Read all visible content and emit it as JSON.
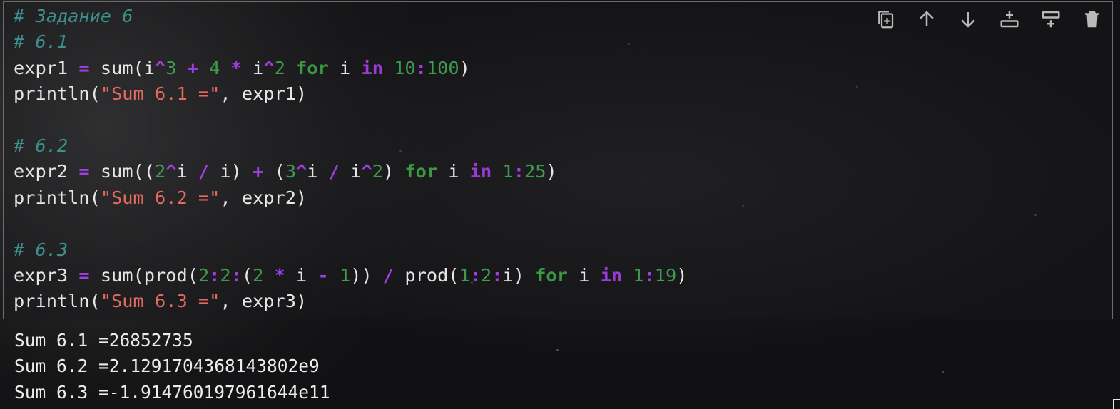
{
  "cell": {
    "lines": [
      [
        {
          "t": "# Задание 6",
          "c": "cm"
        }
      ],
      [
        {
          "t": "# 6.1",
          "c": "cm"
        }
      ],
      [
        {
          "t": "expr1 "
        },
        {
          "t": "=",
          "c": "op"
        },
        {
          "t": " sum(i"
        },
        {
          "t": "^",
          "c": "op"
        },
        {
          "t": "3",
          "c": "nm"
        },
        {
          "t": " "
        },
        {
          "t": "+",
          "c": "op"
        },
        {
          "t": " "
        },
        {
          "t": "4",
          "c": "nm"
        },
        {
          "t": " "
        },
        {
          "t": "*",
          "c": "op"
        },
        {
          "t": " i"
        },
        {
          "t": "^",
          "c": "op"
        },
        {
          "t": "2",
          "c": "nm"
        },
        {
          "t": " "
        },
        {
          "t": "for",
          "c": "kg"
        },
        {
          "t": " i "
        },
        {
          "t": "in",
          "c": "kw"
        },
        {
          "t": " "
        },
        {
          "t": "10",
          "c": "nm"
        },
        {
          "t": ":",
          "c": "op"
        },
        {
          "t": "100",
          "c": "nm"
        },
        {
          "t": ")"
        }
      ],
      [
        {
          "t": "println("
        },
        {
          "t": "\"Sum 6.1 =\"",
          "c": "st"
        },
        {
          "t": ", expr1)"
        }
      ],
      [],
      [
        {
          "t": "# 6.2",
          "c": "cm"
        }
      ],
      [
        {
          "t": "expr2 "
        },
        {
          "t": "=",
          "c": "op"
        },
        {
          "t": " sum(("
        },
        {
          "t": "2",
          "c": "nm"
        },
        {
          "t": "^",
          "c": "op"
        },
        {
          "t": "i "
        },
        {
          "t": "/",
          "c": "op"
        },
        {
          "t": " i) "
        },
        {
          "t": "+",
          "c": "op"
        },
        {
          "t": " ("
        },
        {
          "t": "3",
          "c": "nm"
        },
        {
          "t": "^",
          "c": "op"
        },
        {
          "t": "i "
        },
        {
          "t": "/",
          "c": "op"
        },
        {
          "t": " i"
        },
        {
          "t": "^",
          "c": "op"
        },
        {
          "t": "2",
          "c": "nm"
        },
        {
          "t": ") "
        },
        {
          "t": "for",
          "c": "kg"
        },
        {
          "t": " i "
        },
        {
          "t": "in",
          "c": "kw"
        },
        {
          "t": " "
        },
        {
          "t": "1",
          "c": "nm"
        },
        {
          "t": ":",
          "c": "op"
        },
        {
          "t": "25",
          "c": "nm"
        },
        {
          "t": ")"
        }
      ],
      [
        {
          "t": "println("
        },
        {
          "t": "\"Sum 6.2 =\"",
          "c": "st"
        },
        {
          "t": ", expr2)"
        }
      ],
      [],
      [
        {
          "t": "# 6.3",
          "c": "cm"
        }
      ],
      [
        {
          "t": "expr3 "
        },
        {
          "t": "=",
          "c": "op"
        },
        {
          "t": " sum(prod("
        },
        {
          "t": "2",
          "c": "nm"
        },
        {
          "t": ":",
          "c": "op"
        },
        {
          "t": "2",
          "c": "nm"
        },
        {
          "t": ":",
          "c": "op"
        },
        {
          "t": "("
        },
        {
          "t": "2",
          "c": "nm"
        },
        {
          "t": " "
        },
        {
          "t": "*",
          "c": "op"
        },
        {
          "t": " i "
        },
        {
          "t": "-",
          "c": "op"
        },
        {
          "t": " "
        },
        {
          "t": "1",
          "c": "nm"
        },
        {
          "t": ")) "
        },
        {
          "t": "/",
          "c": "op"
        },
        {
          "t": " prod("
        },
        {
          "t": "1",
          "c": "nm"
        },
        {
          "t": ":",
          "c": "op"
        },
        {
          "t": "2",
          "c": "nm"
        },
        {
          "t": ":",
          "c": "op"
        },
        {
          "t": "i) "
        },
        {
          "t": "for",
          "c": "kg"
        },
        {
          "t": " i "
        },
        {
          "t": "in",
          "c": "kw"
        },
        {
          "t": " "
        },
        {
          "t": "1",
          "c": "nm"
        },
        {
          "t": ":",
          "c": "op"
        },
        {
          "t": "19",
          "c": "nm"
        },
        {
          "t": ")"
        }
      ],
      [
        {
          "t": "println("
        },
        {
          "t": "\"Sum 6.3 =\"",
          "c": "st"
        },
        {
          "t": ", expr3)"
        }
      ]
    ]
  },
  "toolbar": {
    "icons": [
      "copy-cell-icon",
      "move-up-icon",
      "move-down-icon",
      "insert-below-icon",
      "insert-above-icon",
      "delete-icon"
    ],
    "color": "#b9b9b9"
  },
  "output": {
    "lines": [
      "Sum 6.1 =26852735",
      "Sum 6.2 =2.1291704368143802e9",
      "Sum 6.3 =-1.914760197961644e11"
    ]
  },
  "colors": {
    "comment": "#3d8f8a",
    "keyword": "#9b3bd6",
    "for_keyword": "#3a9a43",
    "number": "#3e9b4e",
    "string": "#e4695f",
    "operator": "#a03de3",
    "text": "#e6e6e6"
  }
}
